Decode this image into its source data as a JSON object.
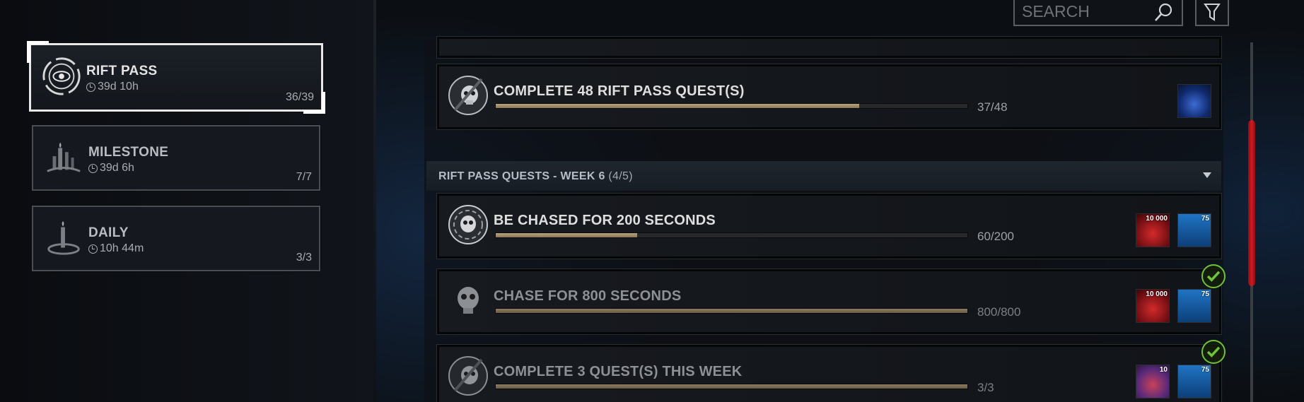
{
  "search": {
    "placeholder": "SEARCH"
  },
  "categories": [
    {
      "title": "RIFT PASS",
      "timer": "39d 10h",
      "count": "36/39"
    },
    {
      "title": "MILESTONE",
      "timer": "39d 6h",
      "count": "7/7"
    },
    {
      "title": "DAILY",
      "timer": "10h 44m",
      "count": "3/3"
    }
  ],
  "top_quest": {
    "title": "COMPLETE 48 RIFT PASS QUEST(S)",
    "progress_text": "37/48",
    "progress": 0.771
  },
  "section": {
    "title": "RIFT PASS QUESTS - WEEK 6",
    "count": "(4/5)"
  },
  "quests": [
    {
      "title": "BE CHASED FOR 200 SECONDS",
      "progress_text": "60/200",
      "progress": 0.3,
      "rewards": [
        {
          "type": "bloodpoints",
          "amount": "10 000"
        },
        {
          "type": "rift-fragments",
          "amount": "75"
        }
      ]
    },
    {
      "title": "CHASE FOR 800 SECONDS",
      "progress_text": "800/800",
      "progress": 1.0,
      "completed": true,
      "rewards": [
        {
          "type": "bloodpoints",
          "amount": "10 000"
        },
        {
          "type": "rift-fragments",
          "amount": "75"
        }
      ]
    },
    {
      "title": "COMPLETE 3 QUEST(S) THIS WEEK",
      "progress_text": "3/3",
      "progress": 1.0,
      "completed": true,
      "rewards": [
        {
          "type": "auric-cells",
          "amount": "10"
        },
        {
          "type": "rift-fragments",
          "amount": "75"
        }
      ]
    }
  ],
  "colors": {
    "accent": "#d21a22",
    "complete": "#6fc23a",
    "bar_fill": "#b9a37e"
  }
}
